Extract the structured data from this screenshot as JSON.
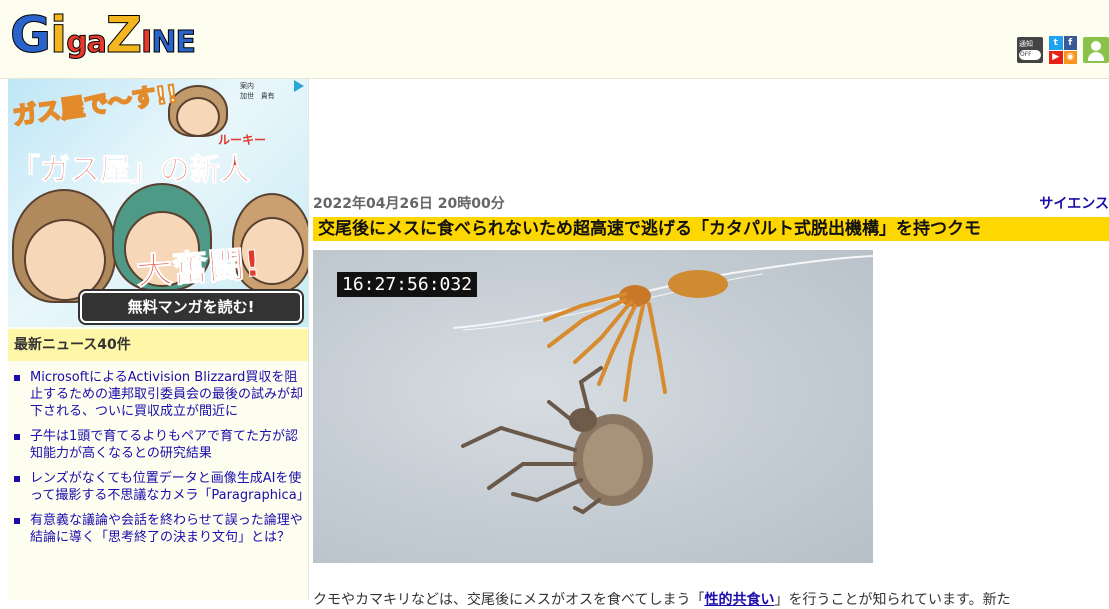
{
  "header": {
    "logo": {
      "g": "G",
      "i": "i",
      "ga": "ga",
      "z": "Z",
      "i2": "I",
      "n": "N",
      "e": "E"
    },
    "notify_label": "通知",
    "notify_state": "OFF",
    "social_icons": [
      "twitter-icon",
      "facebook-icon",
      "youtube-icon",
      "rss-icon"
    ]
  },
  "sidebar": {
    "ad": {
      "top_text": "ガス屋で〜す!!",
      "headline": "「ガス屋」の新人",
      "ruby": "ルーキー",
      "big_text": "大奮闘!",
      "cta": "無料マンガを読む!",
      "names": [
        "加世",
        "貴有"
      ],
      "small_label": "案内"
    },
    "news_heading": "最新ニュース40件",
    "news": [
      "MicrosoftによるActivision Blizzard買収を阻止するための連邦取引委員会の最後の試みが却下される、ついに買収成立が間近に",
      "子牛は1頭で育てるよりもペアで育てた方が認知能力が高くなるとの研究結果",
      "レンズがなくても位置データと画像生成AIを使って撮影する不思議なカメラ「Paragraphica」",
      "有意義な議論や会話を終わらせて誤った論理や結論に導く「思考終了の決まり文句」とは？"
    ]
  },
  "article": {
    "date": "2022年04月26日 20時00分",
    "category": "サイエンス",
    "title": "交尾後にメスに食べられないため超高速で逃げる「カタパルト式脱出機構」を持つクモ",
    "timestamp": "16:27:56:032",
    "body_start": "クモやカマキリなどは、交尾後にメスがオスを食べてしまう「",
    "body_link": "性的共食い",
    "body_end": "」を行うことが知られています。新た"
  },
  "colors": {
    "header_bg": "#fdfdf0",
    "title_bg": "#ffd700",
    "news_head_bg": "#fff7a8",
    "link": "#1a0dab"
  }
}
